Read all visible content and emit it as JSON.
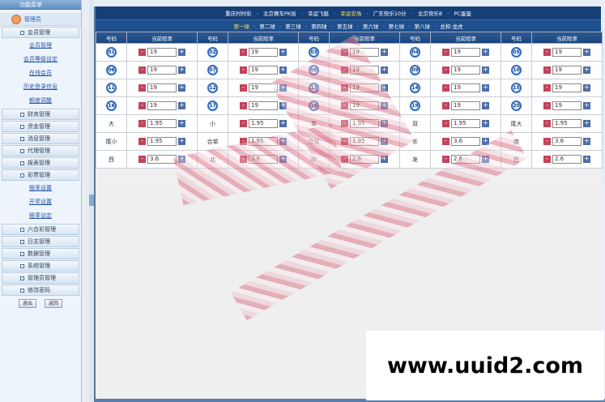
{
  "sidebar": {
    "header": "功能菜单",
    "user": "管理员",
    "groups": [
      {
        "label": "会员管理",
        "subs": [
          "会员管理",
          "会员等级设定",
          "在线会员",
          "历史登录信息",
          "额度调整"
        ]
      },
      {
        "label": "财务管理"
      },
      {
        "label": "资金管理"
      },
      {
        "label": "消息管理"
      },
      {
        "label": "代理管理"
      },
      {
        "label": "报表管理"
      },
      {
        "label": "彩票管理",
        "subs": [
          "赔率设置",
          "开奖设置",
          "赔率设定"
        ]
      },
      {
        "label": "六合彩管理"
      },
      {
        "label": "日志管理"
      },
      {
        "label": "数据管理"
      },
      {
        "label": "系统管理"
      },
      {
        "label": "管理员管理"
      },
      {
        "label": "修改密码"
      }
    ],
    "btn_logout": "退出",
    "btn_home": "返回"
  },
  "nav_games": [
    "重庆时时彩",
    "北京赛车PK拾",
    "幸运飞艇",
    "幸运农场",
    "广东快乐10分",
    "北京快乐8",
    "PC蛋蛋"
  ],
  "nav_games_active": "幸运农场",
  "nav_balls": [
    "第一球",
    "第二球",
    "第三球",
    "第四球",
    "第五球",
    "第六球",
    "第七球",
    "第八球",
    "总和·龙虎"
  ],
  "nav_balls_active": "第一球",
  "table": {
    "col_num": "号码",
    "col_rate": "当前赔率",
    "rows": [
      [
        [
          "01",
          "19"
        ],
        [
          "02",
          "19"
        ],
        [
          "03",
          "19"
        ],
        [
          "04",
          "19"
        ],
        [
          "05",
          "19"
        ]
      ],
      [
        [
          "06",
          "19"
        ],
        [
          "07",
          "19"
        ],
        [
          "08",
          "19"
        ],
        [
          "09",
          "19"
        ],
        [
          "10",
          "19"
        ]
      ],
      [
        [
          "11",
          "19"
        ],
        [
          "12",
          "19"
        ],
        [
          "13",
          "19"
        ],
        [
          "14",
          "19"
        ],
        [
          "15",
          "19"
        ]
      ],
      [
        [
          "16",
          "19"
        ],
        [
          "17",
          "19"
        ],
        [
          "18",
          "19"
        ],
        [
          "19",
          "19"
        ],
        [
          "20",
          "19"
        ]
      ],
      [
        [
          "大",
          "1.95"
        ],
        [
          "小",
          "1.95"
        ],
        [
          "单",
          "1.95"
        ],
        [
          "双",
          "1.95"
        ],
        [
          "尾大",
          "1.95"
        ]
      ],
      [
        [
          "尾小",
          "1.95"
        ],
        [
          "合单",
          "1.95"
        ],
        [
          "合双",
          "1.95"
        ],
        [
          "东",
          "3.6"
        ],
        [
          "南",
          "3.6"
        ]
      ],
      [
        [
          "西",
          "3.6"
        ],
        [
          "北",
          "3.6"
        ],
        [
          "中",
          "2.6"
        ],
        [
          "发",
          "2.6"
        ],
        [
          "白",
          "2.6"
        ]
      ]
    ]
  },
  "watermark": "www.uuid2.com"
}
